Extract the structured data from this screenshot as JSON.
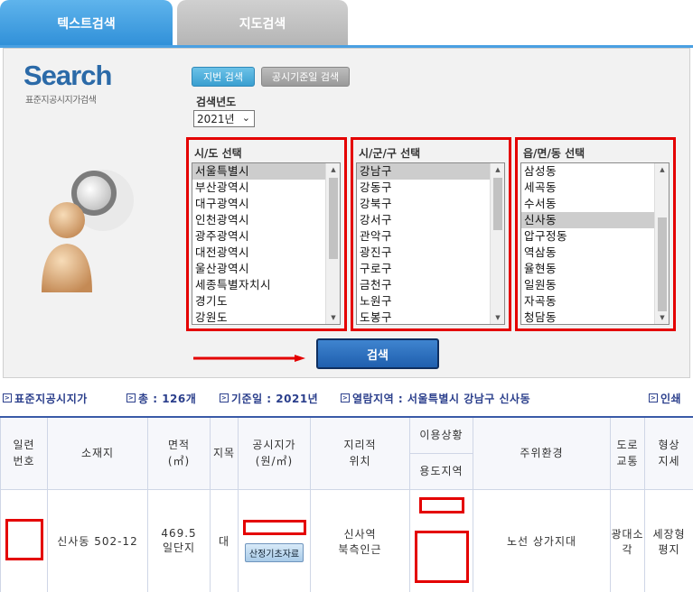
{
  "tabs": [
    {
      "label": "텍스트검색",
      "active": true
    },
    {
      "label": "지도검색",
      "active": false
    }
  ],
  "panel": {
    "logo_text": "Search",
    "logo_sub": "표준지공시지가검색",
    "mode_buttons": [
      "지번 검색",
      "공시기준일 검색"
    ],
    "year_label": "검색년도",
    "year_value": "2021년",
    "search_button": "검색",
    "accent_color": "#e40000"
  },
  "lists": [
    {
      "title": "시/도 선택",
      "items": [
        "서울특별시",
        "부산광역시",
        "대구광역시",
        "인천광역시",
        "광주광역시",
        "대전광역시",
        "울산광역시",
        "세종특별자치시",
        "경기도",
        "강원도"
      ],
      "selected": "서울특별시"
    },
    {
      "title": "시/군/구 선택",
      "items": [
        "강남구",
        "강동구",
        "강북구",
        "강서구",
        "관악구",
        "광진구",
        "구로구",
        "금천구",
        "노원구",
        "도봉구"
      ],
      "selected": "강남구"
    },
    {
      "title": "읍/면/동 선택",
      "items": [
        "삼성동",
        "세곡동",
        "수서동",
        "신사동",
        "압구정동",
        "역삼동",
        "율현동",
        "일원동",
        "자곡동",
        "청담동"
      ],
      "selected": "신사동"
    }
  ],
  "info": {
    "title": "표준지공시지가",
    "total": "총 : 126개",
    "base_date": "기준일 : 2021년",
    "region": "열람지역 : 서울특별시 강남구 신사동",
    "print": "인쇄"
  },
  "table": {
    "headers": {
      "serial": "일련\n번호",
      "address": "소재지",
      "area": "면적\n(㎡)",
      "category": "지목",
      "price": "공시지가\n(원/㎡)",
      "location": "지리적\n위치",
      "usage": "이용상황",
      "zone": "용도지역",
      "surroundings": "주위환경",
      "road": "도로\n교통",
      "shape": "형상\n지세"
    },
    "row": {
      "address": "신사동 502-12",
      "area": "469.5\n일단지",
      "category": "대",
      "price_button": "산정기초자료",
      "location": "신사역\n북측인근",
      "surroundings": "노선 상가지대",
      "road": "광대소각",
      "shape": "세장형\n평지"
    }
  }
}
